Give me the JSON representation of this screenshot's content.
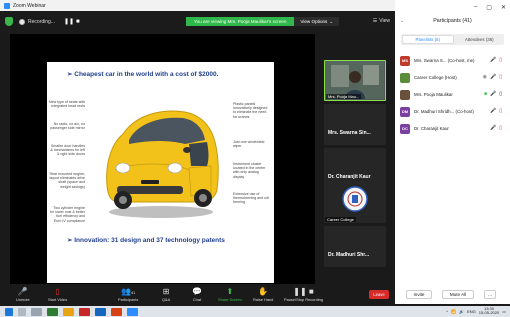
{
  "window": {
    "title": "Zoom Webinar"
  },
  "topbar": {
    "recording_label": "Recording...",
    "pause_icon": "pause-icon",
    "stop_icon": "stop-icon",
    "banner_text": "You are viewing Mrs. Pooja Maulikar's screen",
    "view_options_label": "View Options",
    "view_label": "View"
  },
  "slide": {
    "title": "➢ Cheapest car in the world with a cost of $2000.",
    "subtitle": "➢ Innovation:  31 design and 37 technology patents",
    "callouts_left": [
      "New type of seats with integrated head rests",
      "No radio, no a/c, no passenger side mirror",
      "Smaller door handles & mechanisms for left & right side doors",
      "Rear mounted engine, layout eliminates drive shaft (space and weight savings)",
      "Two cylinder engine for lower cost & better fuel efficiency and Euro IV compliance"
    ],
    "callouts_right": [
      "Plastic panels innovatively designed to eliminate the need for screws",
      "Just one windshield wiper",
      "Instrument cluster located in the center with only analog display",
      "Extensive use of thermoforming and roll forming"
    ]
  },
  "gallery": [
    {
      "name": "Mrs. Pooja Mau...",
      "type": "video"
    },
    {
      "name": "Mrs. Swarna Sin...",
      "type": "name"
    },
    {
      "name": "Dr. Charanjit Kaur",
      "type": "name"
    },
    {
      "name": "Career College",
      "type": "logo"
    },
    {
      "name": "Dr. Madhuri Shr...",
      "type": "name"
    }
  ],
  "panel": {
    "title": "Participants (41)",
    "tab_panelists": "Panelists (5)",
    "tab_attendees": "Attendees (36)",
    "participants": [
      {
        "initials": "MS",
        "color": "#c0392b",
        "name": "Mrs. Swarna S... (Co-host, me)",
        "mic": "off",
        "cam": "off"
      },
      {
        "initials": "",
        "color": "#5b8c3a",
        "name": "Career College (Host)",
        "mic": "off",
        "cam": "off"
      },
      {
        "initials": "",
        "color": "#6a4f3a",
        "name": "Mrs. Pooja Maulikar",
        "mic": "on",
        "cam": "on"
      },
      {
        "initials": "DM",
        "color": "#7b3fa0",
        "name": "Dr. Madhuri Shridh... (Co-host)",
        "mic": "off",
        "cam": "off"
      },
      {
        "initials": "DC",
        "color": "#7b3fa0",
        "name": "Dr. Charanjit Kaur",
        "mic": "off",
        "cam": "off"
      }
    ],
    "invite_label": "Invite",
    "mute_all_label": "Mute All",
    "more_label": "..."
  },
  "toolbar": {
    "unmute": "Unmute",
    "start_video": "Start Video",
    "participants": "Participants",
    "participants_count": "41",
    "qa": "Q&A",
    "chat": "Chat",
    "share_screen": "Share Screen",
    "raise_hand": "Raise Hand",
    "pause_stop": "Pause/Stop Recording",
    "leave": "Leave"
  },
  "taskbar": {
    "lang": "ENG",
    "time": "13:30",
    "date": "15-05-2020"
  }
}
